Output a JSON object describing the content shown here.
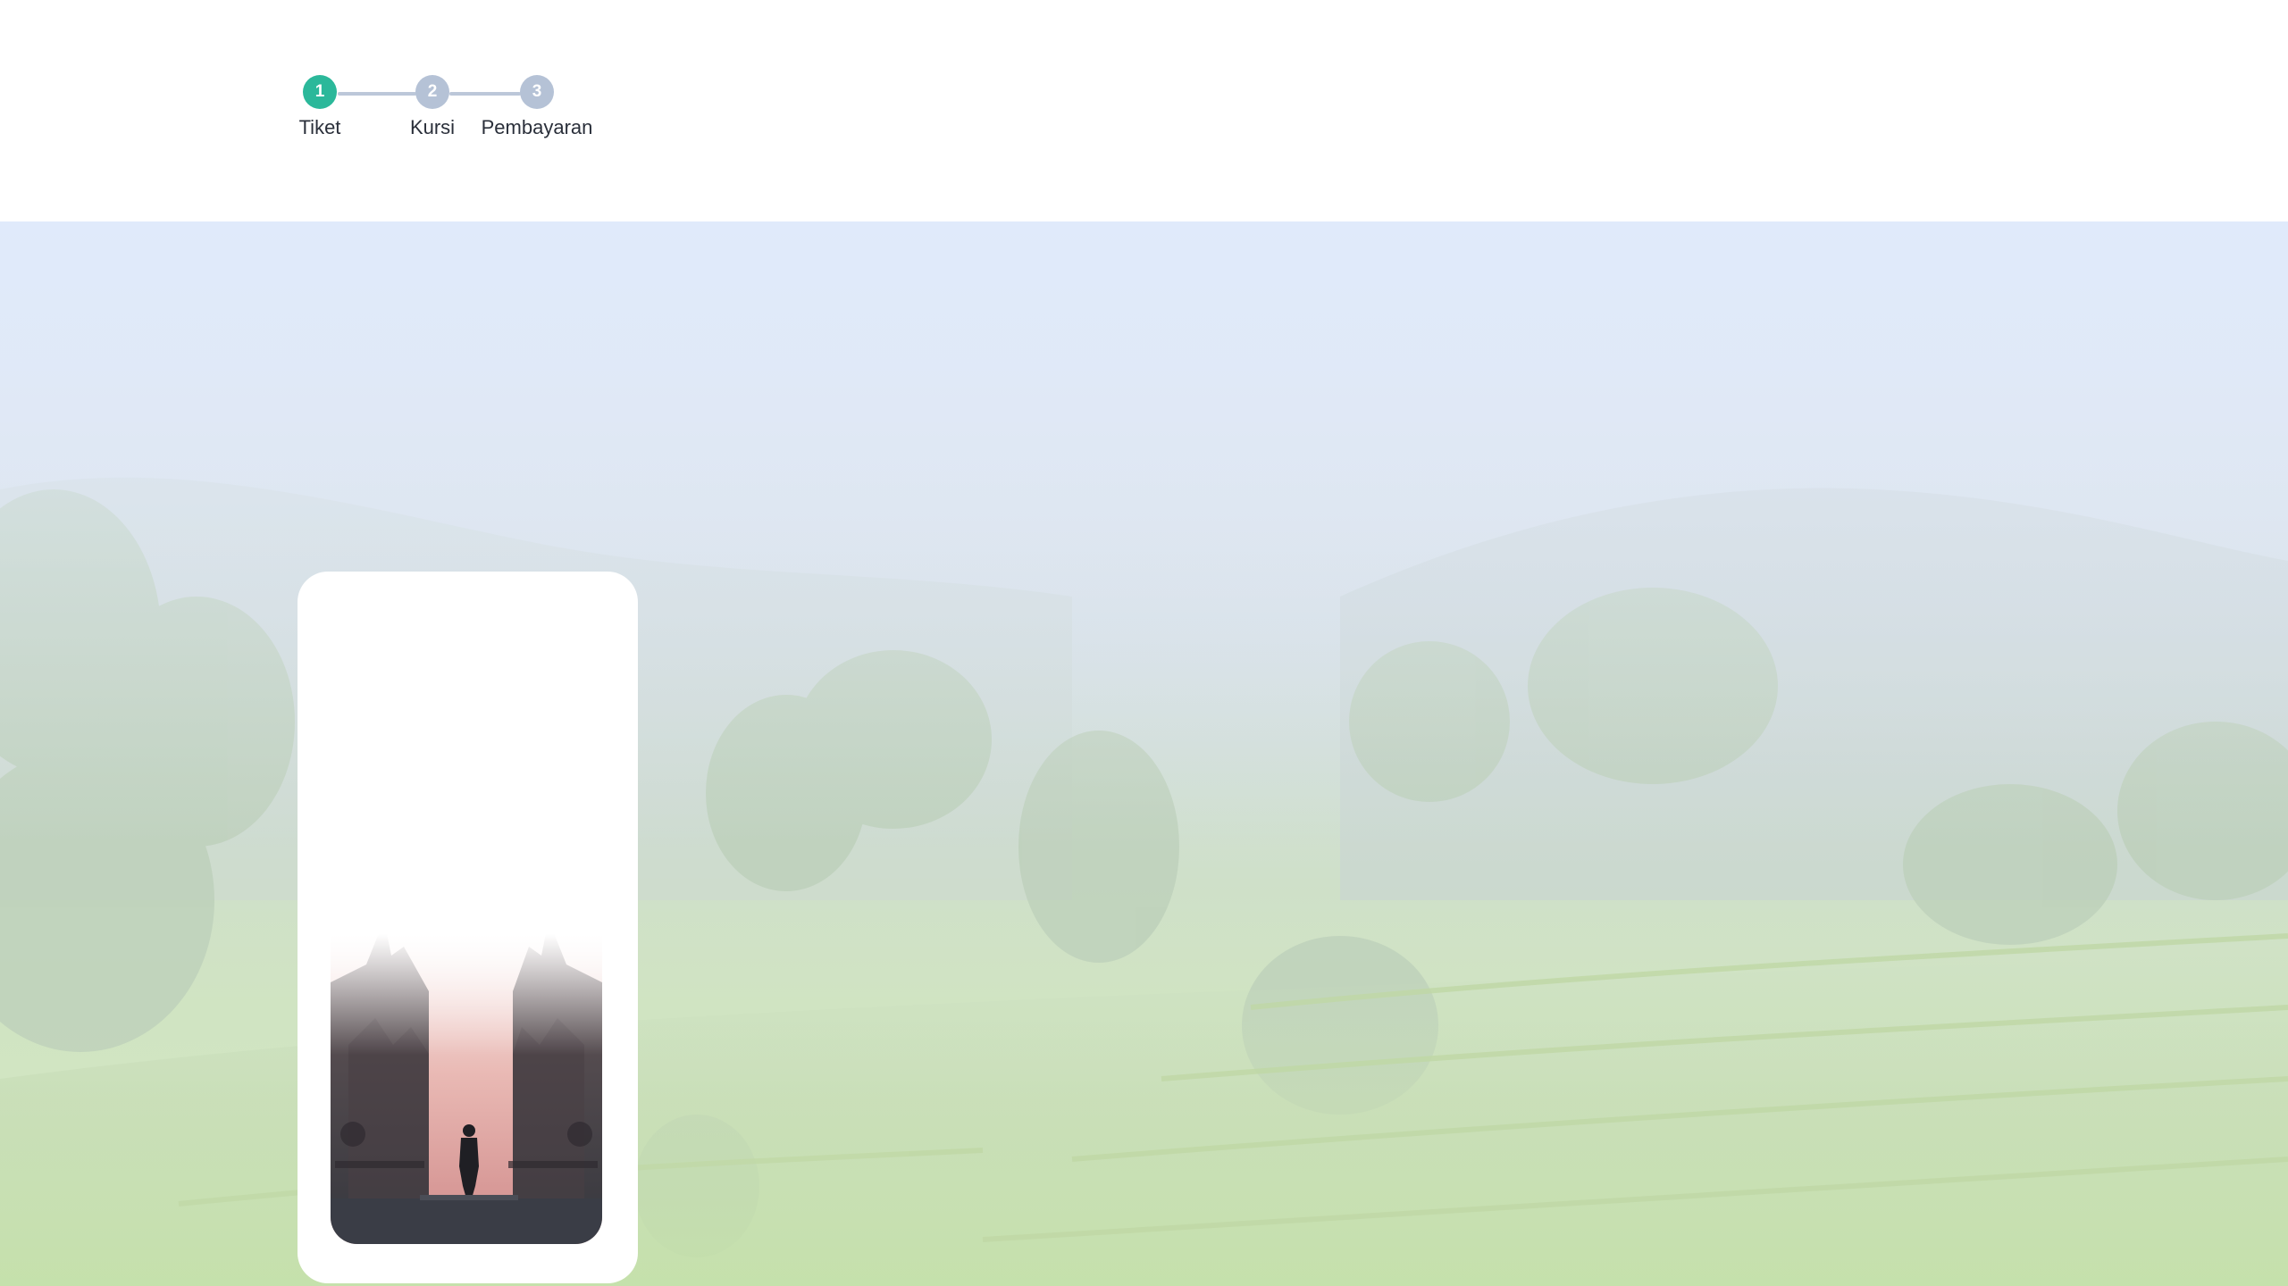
{
  "stepper": {
    "steps": [
      {
        "number": "1",
        "label": "Tiket",
        "state": "active"
      },
      {
        "number": "2",
        "label": "Kursi",
        "state": "inactive"
      },
      {
        "number": "3",
        "label": "Pembayaran",
        "state": "inactive"
      }
    ],
    "active_color": "#2bb89a",
    "inactive_color": "#b5c2d6"
  },
  "hero": {
    "background_image": "misty-rice-terraces",
    "card_image": "temple-gate-silhouette"
  }
}
